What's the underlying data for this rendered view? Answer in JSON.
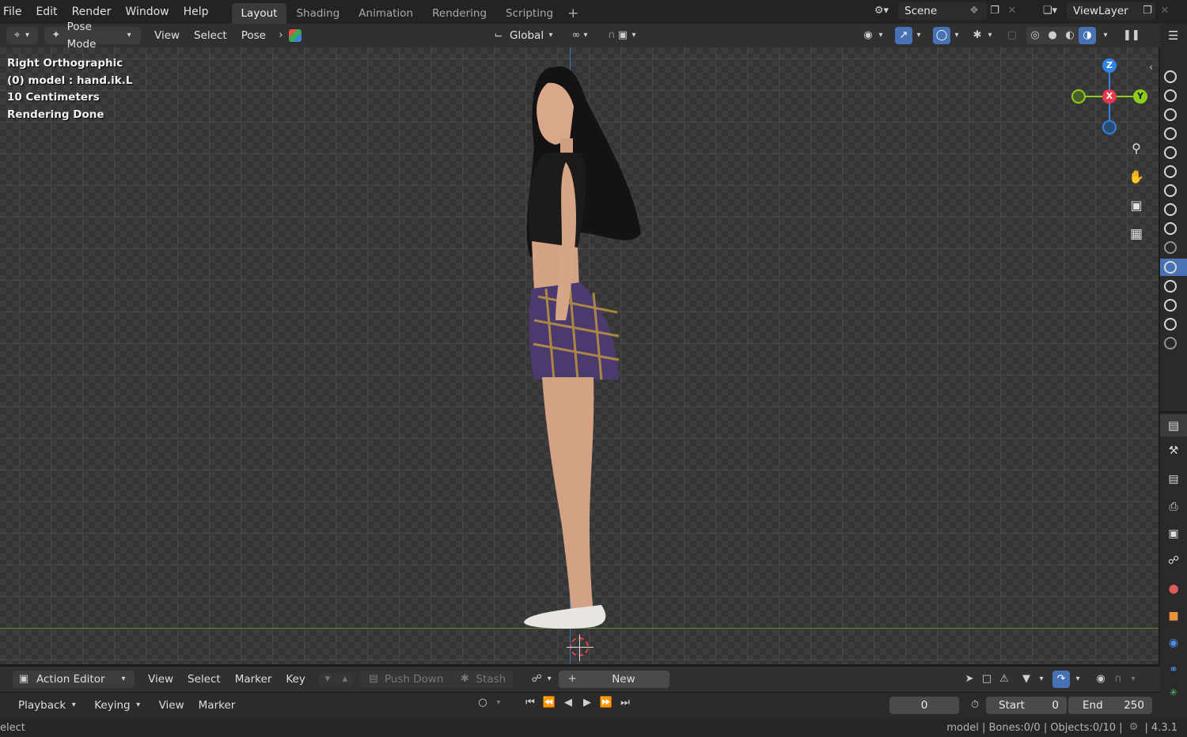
{
  "topbar": {
    "menus": [
      "File",
      "Edit",
      "Render",
      "Window",
      "Help"
    ],
    "workspaces": [
      "Layout",
      "Shading",
      "Animation",
      "Rendering",
      "Scripting"
    ],
    "active_workspace": "Layout",
    "add_tab": "+",
    "scene_label": "Scene",
    "viewlayer_label": "ViewLayer"
  },
  "viewport_header": {
    "mode": "Pose Mode",
    "menus": [
      "View",
      "Select",
      "Pose"
    ],
    "transform_orientation": "Global"
  },
  "viewport": {
    "info_lines": [
      "Right Orthographic",
      "(0) model : hand.ik.L",
      "10 Centimeters",
      "Rendering Done"
    ],
    "gizmo": {
      "z": "Z",
      "x": "X",
      "y": "Y"
    },
    "colors": {
      "x_axis": "#e8394d",
      "y_axis": "#8ccc1d",
      "z_axis": "#2f84e3",
      "floor_line": "#5c8a2d"
    }
  },
  "action_editor": {
    "editor": "Action Editor",
    "menus": [
      "View",
      "Select",
      "Marker",
      "Key"
    ],
    "push_down": "Push Down",
    "stash": "Stash",
    "new_label": "New"
  },
  "playback": {
    "menus": [
      "Playback",
      "Keying",
      "View",
      "Marker"
    ],
    "current_frame": "0",
    "start_label": "Start",
    "start_value": "0",
    "end_label": "End",
    "end_value": "250"
  },
  "statusbar": {
    "left": "elect",
    "right": "model | Bones:0/0 | Objects:0/10 |",
    "version": "4.3.1"
  }
}
